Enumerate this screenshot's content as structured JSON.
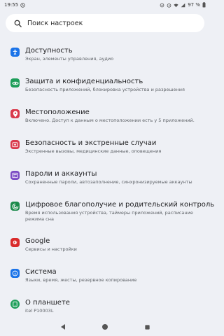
{
  "status": {
    "time": "19:55",
    "battery": "97 %"
  },
  "search": {
    "placeholder": "Поиск настроек",
    "icon": "search-icon"
  },
  "items": [
    {
      "title": "Доступность",
      "subtitle": "Экран, элементы управления, аудио",
      "icon": "accessibility-icon",
      "color": "#1a73e8"
    },
    {
      "title": "Защита и конфиденциальность",
      "subtitle": "Безопасность приложений, блокировка устройства и разрешения",
      "icon": "eye-icon",
      "color": "#1e9e5a"
    },
    {
      "title": "Местоположение",
      "subtitle": "Включено. Доступ к данным о местоположении есть у 5 приложений.",
      "icon": "location-pin-icon",
      "color": "#d93a4c"
    },
    {
      "title": "Безопасность и экстренные случаи",
      "subtitle": "Экстренные вызовы, медицинские данные, оповещения",
      "icon": "emergency-icon",
      "color": "#d93a4c"
    },
    {
      "title": "Пароли и аккаунты",
      "subtitle": "Сохраненные пароли, автозаполнение, синхронизируемые аккаунты",
      "icon": "accounts-icon",
      "color": "#7b4bc4"
    },
    {
      "title": "Цифровое благополучие и родительский контроль",
      "subtitle": "Время использования устройства, таймеры приложений, расписание режима сна",
      "icon": "wellbeing-icon",
      "color": "#1b8a4a"
    },
    {
      "title": "Google",
      "subtitle": "Сервисы и настройки",
      "icon": "google-icon",
      "color": "#d92b2b"
    },
    {
      "title": "Система",
      "subtitle": "Языки, время, жесты, резервное копирование",
      "icon": "system-info-icon",
      "color": "#1a73e8"
    },
    {
      "title": "О планшете",
      "subtitle": "itel P10003L",
      "icon": "tablet-icon",
      "color": "#1e9e5a"
    }
  ],
  "navbar": {
    "back": "back-triangle-icon",
    "home": "home-circle-icon",
    "recents": "recents-square-icon"
  }
}
